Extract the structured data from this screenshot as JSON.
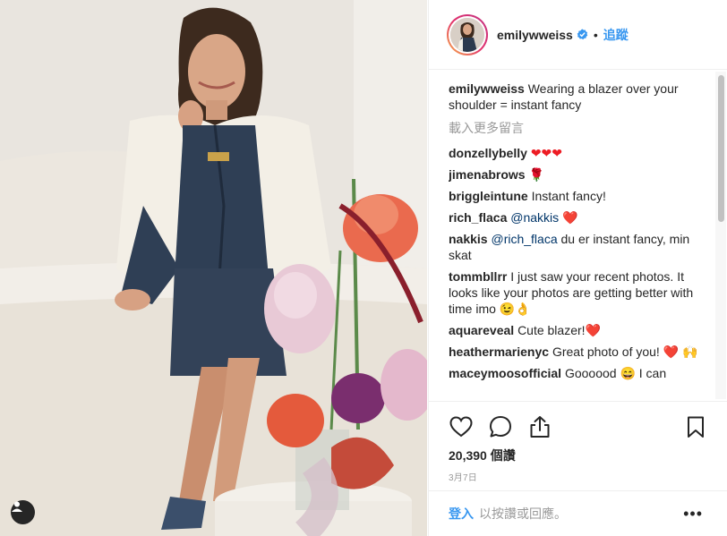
{
  "post": {
    "username": "emilywweiss",
    "follow_label": "追蹤",
    "separator": "•",
    "caption_user": "emilywweiss",
    "caption_text": "Wearing a blazer over your shoulder = instant fancy",
    "load_more": "載入更多留言",
    "likes": "20,390 個讚",
    "date": "3月7日"
  },
  "comments": [
    {
      "user": "donzellybelly",
      "text": "❤❤❤"
    },
    {
      "user": "jimenabrows",
      "text": "🌹"
    },
    {
      "user": "briggleintune",
      "text": "Instant fancy!"
    },
    {
      "user": "rich_flaca",
      "mention": "@nakkis",
      "text": "❤️"
    },
    {
      "user": "nakkis",
      "mention": "@rich_flaca",
      "text": "du er instant fancy, min skat"
    },
    {
      "user": "tommbllrr",
      "text": "I just saw your recent photos. It looks like your photos are getting better with time imo 😉👌"
    },
    {
      "user": "aquareveal",
      "text": "Cute blazer!❤️"
    },
    {
      "user": "heathermarienyc",
      "text": "Great photo of you! ❤️ 🙌"
    },
    {
      "user": "maceymoosofficial",
      "text": "Goooood 😄 I can"
    }
  ],
  "footer": {
    "login_link": "登入",
    "login_text": "以按讚或回應。",
    "more": "•••"
  },
  "icons": {
    "like": "heart-outline-icon",
    "comment": "comment-bubble-icon",
    "share": "share-icon",
    "save": "bookmark-icon",
    "verified": "verified-badge-icon",
    "user_tag": "user-tag-icon"
  },
  "colors": {
    "link_blue": "#3897f0",
    "muted_gray": "#999999",
    "text": "#262626",
    "verified_blue": "#3897f0"
  }
}
